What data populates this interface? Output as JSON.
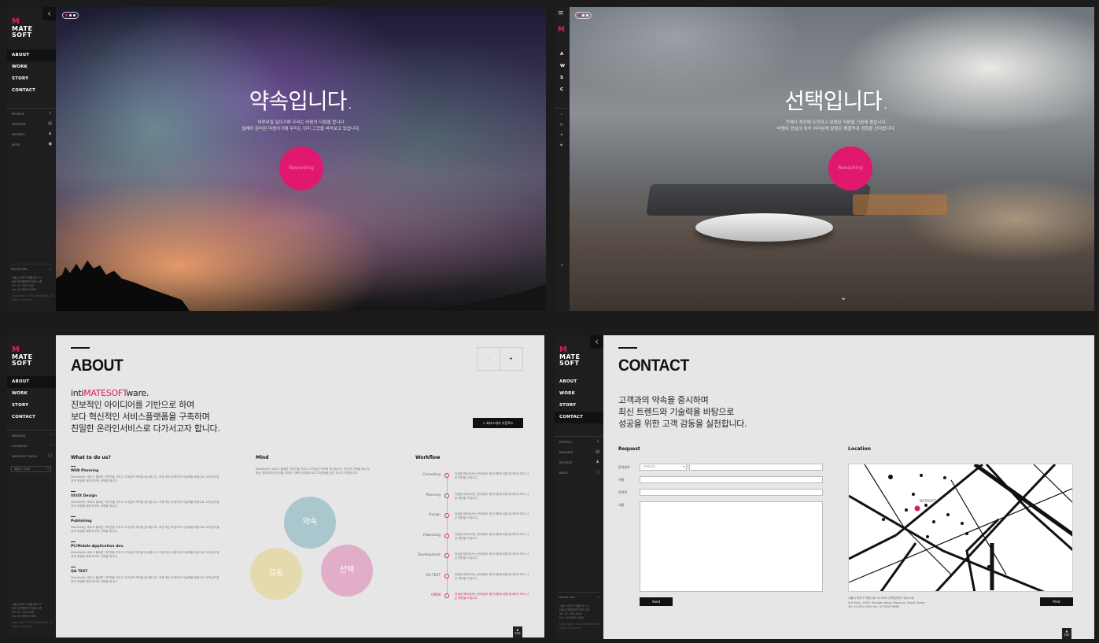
{
  "brand": {
    "logo_top": "M",
    "logo_bottom_1": "MATE",
    "logo_bottom_2": "SOFT"
  },
  "nav": {
    "items": [
      "ABOUT",
      "WORK",
      "STORY",
      "CONTACT"
    ],
    "collapsed_items": [
      "A",
      "W",
      "S",
      "C"
    ]
  },
  "subnav": {
    "items": [
      "PROFILE",
      "REQUEST",
      "RECRUIT",
      "BLOG"
    ]
  },
  "subnav_about": {
    "items": [
      "REQUEST",
      "LOCATION",
      "MATESOFT BLOG"
    ],
    "select_placeholder": "패밀리 사이트"
  },
  "family": {
    "label": "Family Site",
    "plus": "+"
  },
  "address": {
    "line1": "서울시 마포구 매봉산로 37",
    "line2": "DMC산학협력연구센터 4층",
    "line3": "Tel. 02. 309.1900",
    "line4": "Fax. 02 6959.5968",
    "copyright": "Copyright © 2016 MateSoft. All Rights reserved."
  },
  "hero1": {
    "title": "약속입니다.",
    "sub1": "미루어질 일이기에 우리는 마음의 다짐을 합니다",
    "sub2": "설레어 준비된 마음이기에 우리는 이미 그곳을 바라보고 있습니다.",
    "button": "Rewarding"
  },
  "hero2": {
    "title": "선택입니다.",
    "sub1": "언제나 최선에 도전하고 보람된 마음을 가슴에 품습니다.",
    "sub2": "바램이 현실이 되어 여러분께 알맞은 해결책과 경험을 선사합니다.",
    "button": "Rewarding"
  },
  "about": {
    "title": "ABOUT",
    "lead_prefix": "inti",
    "lead_brand": "MATESOFT",
    "lead_suffix": "ware.",
    "lead2": "진보적인 아이디어를 기반으로 하여",
    "lead3": "보다 혁신적인 서비스플랫폼을 구축하며",
    "lead4": "친밀한 온라인서비스로 다가서고자 합니다.",
    "download": "회사소개서 다운로드",
    "what_title": "What to do us?",
    "what_items": [
      {
        "title": "WEB Planning",
        "desc": "MateSoft는 바르고 올바른 가치관을 가지고 고객님의 약속을 중시합니다. 또한 최신 트렌드와 기술력을 바탕으로 고객님의 발전과 목표를 위해 최고의 선택을 합니다."
      },
      {
        "title": "UI/UX Design",
        "desc": "MateSoft는 바르고 올바른 가치관을 가지고 고객님의 약속을 중시합니다. 또한 최신 트렌드와 기술력을 바탕으로 고객님의 발전과 목표를 위해 최고의 선택을 합니다."
      },
      {
        "title": "Publishing",
        "desc": "MateSoft는 바르고 올바른 가치관을 가지고 고객님의 약속을 중시합니다. 또한 최신 트렌드와 기술력을 바탕으로 고객님의 발전과 목표를 위해 최고의 선택을 합니다."
      },
      {
        "title": "PC/Mobile Application dev.",
        "desc": "MateSoft는 바르고 올바른 가치관을 가지고 고객님의 약속을 중시합니다. 또한 최신 트렌드와 기술력을 바탕으로 고객님의 발전과 목표를 위해 최고의 선택을 합니다."
      },
      {
        "title": "QA TEST",
        "desc": "MateSoft는 바르고 올바른 가치관을 가지고 고객님의 약속을 중시합니다. 또한 최신 트렌드와 기술력을 바탕으로 고객님의 발전과 목표를 위해 최고의 선택을 합니다."
      }
    ],
    "mind_title": "Mind",
    "mind_desc": "MateSoft는 바르고 올바른 가치관을 가지고 고객님의 약속을 중시합니다. 최신의 선택을 합니다. 항상 여러분에게 최선을 다하여 신뢰의 장치합으로 고객감동을 실천 하고자 하겠습니다.",
    "venn": {
      "a": "약속",
      "b": "감동",
      "c": "선택",
      "a_color": "#a9c7cd",
      "b_color": "#e4d9a9",
      "c_color": "#e2a9c4"
    },
    "workflow_title": "Workflow",
    "workflow": [
      {
        "label": "Consulting",
        "desc": "컨설팅 파트에서는 문제점과 개선사항에 대해 분석하여 보다 나은 해안을 드립니다."
      },
      {
        "label": "Planning",
        "desc": "컨설팅 파트에서는 문제점과 개선사항에 대해 분석하여 보다 나은 해안을 드립니다."
      },
      {
        "label": "Design",
        "desc": "컨설팅 파트에서는 문제점과 개선사항에 대해 분석하여 보다 나은 해안을 드립니다."
      },
      {
        "label": "Publishing",
        "desc": "컨설팅 파트에서는 문제점과 개선사항에 대해 분석하여 보다 나은 해안을 드립니다."
      },
      {
        "label": "Development",
        "desc": "컨설팅 파트에서는 문제점과 개선사항에 대해 분석하여 보다 나은 해안을 드립니다."
      },
      {
        "label": "QA TEST",
        "desc": "컨설팅 파트에서는 문제점과 개선사항에 대해 분석하여 보다 나은 해안을 드립니다."
      },
      {
        "label": "OPEN",
        "desc": "컨설팅 파트에서는 문제점과 개선사항에 대해 분석하여 보다 나은 해안을 드립니다."
      }
    ]
  },
  "contact": {
    "title": "CONTACT",
    "lead1": "고객과의 약속을 중시하며",
    "lead2": "최신 트렌드와 기술력을 바탕으로",
    "lead3": "성공을 위한 고객 감동을 실천합니다.",
    "request_title": "Request",
    "labels": [
      "문의분야",
      "이름",
      "연락처",
      "내용"
    ],
    "select_placeholder": "선택하세요",
    "send": "Send",
    "location_title": "Location",
    "map_address1": "서울시 마포구 매봉산로 37 DMC산학협력연구센터 4층",
    "map_address2": "4th Floor, 1649, Sangam-dong, Mapo-gu, Seoul, Korea",
    "map_address3": "Tel. 02-309-1900 Fax. 02 6959 5968",
    "print": "Print",
    "map_pin": "MATESOFT"
  },
  "top_label": "TOP",
  "colors": {
    "accent": "#e0196e",
    "sidebar": "#1e1e1e",
    "content_bg": "#e6e6e6"
  }
}
